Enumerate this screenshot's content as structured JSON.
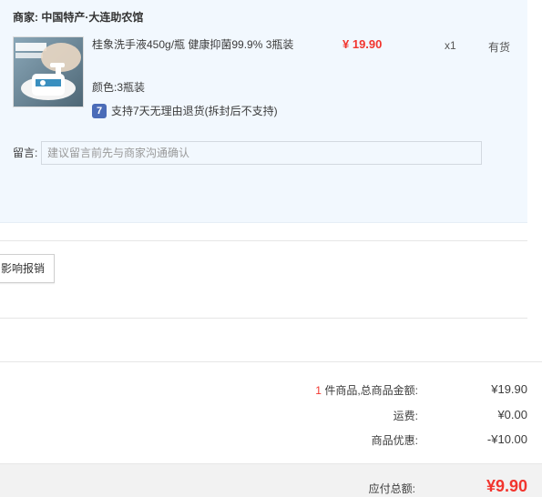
{
  "shop": {
    "label": "商家:",
    "name": "中国特产·大连助农馆"
  },
  "item": {
    "image_alt": "桂象洗手液商品图",
    "image_text": "植物营养 呵护家人健康",
    "title": "桂象洗手液450g/瓶 健康抑菌99.9% 3瓶装",
    "price": "¥ 19.90",
    "quantity": "x1",
    "stock_status": "有货",
    "sku": "颜色:3瓶装",
    "service_icon": "7",
    "service_text": "支持7天无理由退货(拆封后不支持)"
  },
  "note": {
    "label": "留言:",
    "placeholder": "建议留言前先与商家沟通确认"
  },
  "invoice": {
    "button_label": "影响报销"
  },
  "summary": {
    "item_count": "1",
    "count_suffix": " 件商品,总商品金额:",
    "goods_total": "¥19.90",
    "shipping_label": "运费:",
    "shipping_value": "¥0.00",
    "discount_label": "商品优惠:",
    "discount_value": "-¥10.00",
    "payable_label": "应付总额:",
    "payable_value": "¥9.90"
  },
  "colors": {
    "accent_red": "#f2352e",
    "panel_bg": "#f2f8fe",
    "service_icon_blue": "#4b6cb8"
  },
  "icons": {
    "service": "seven-day-return-icon"
  }
}
